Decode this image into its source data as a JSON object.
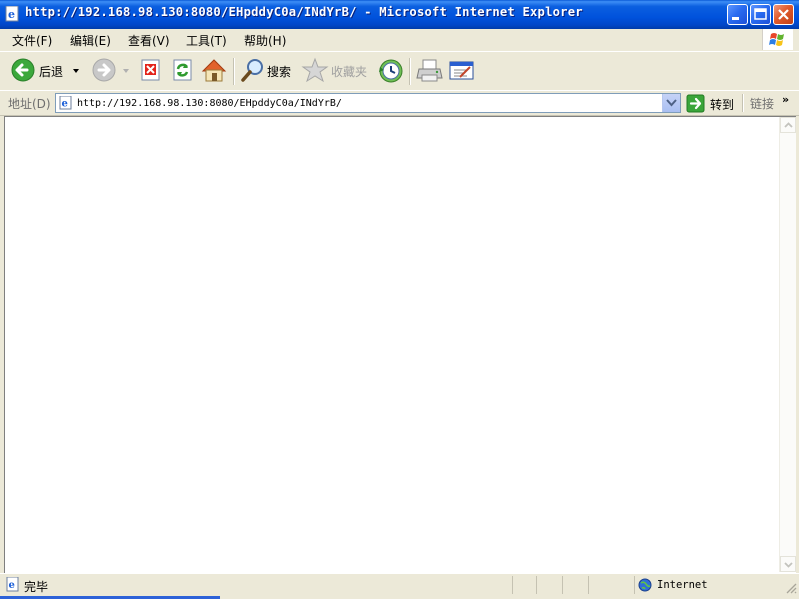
{
  "window": {
    "title": "http://192.168.98.130:8080/EHpddyC0a/INdYrB/ - Microsoft Internet Explorer"
  },
  "menu": [
    {
      "label": "文件(F)"
    },
    {
      "label": "编辑(E)"
    },
    {
      "label": "查看(V)"
    },
    {
      "label": "工具(T)"
    },
    {
      "label": "帮助(H)"
    }
  ],
  "toolbar": {
    "back_label": "后退",
    "search_label": "搜索",
    "favorites_label": "收藏夹"
  },
  "address": {
    "label": "地址(D)",
    "url": "http://192.168.98.130:8080/EHpddyC0a/INdYrB/",
    "go_label": "转到",
    "links_label": "链接",
    "links_chevron": "»"
  },
  "status": {
    "text": "完毕",
    "zone": "Internet"
  },
  "icons": {
    "back": "back-arrow-icon",
    "forward": "forward-arrow-icon",
    "stop": "stop-icon",
    "refresh": "refresh-icon",
    "home": "home-icon",
    "search": "search-icon",
    "favorites": "favorites-star-icon",
    "history": "history-icon",
    "print": "printer-icon",
    "edit": "edit-icon",
    "page": "ie-page-icon",
    "go": "go-arrow-icon",
    "zone": "globe-icon"
  },
  "colors": {
    "titlebar": "#0052dc",
    "chrome": "#ece9d8",
    "content_bg": "#ffffff",
    "close_button": "#e05a2c"
  }
}
